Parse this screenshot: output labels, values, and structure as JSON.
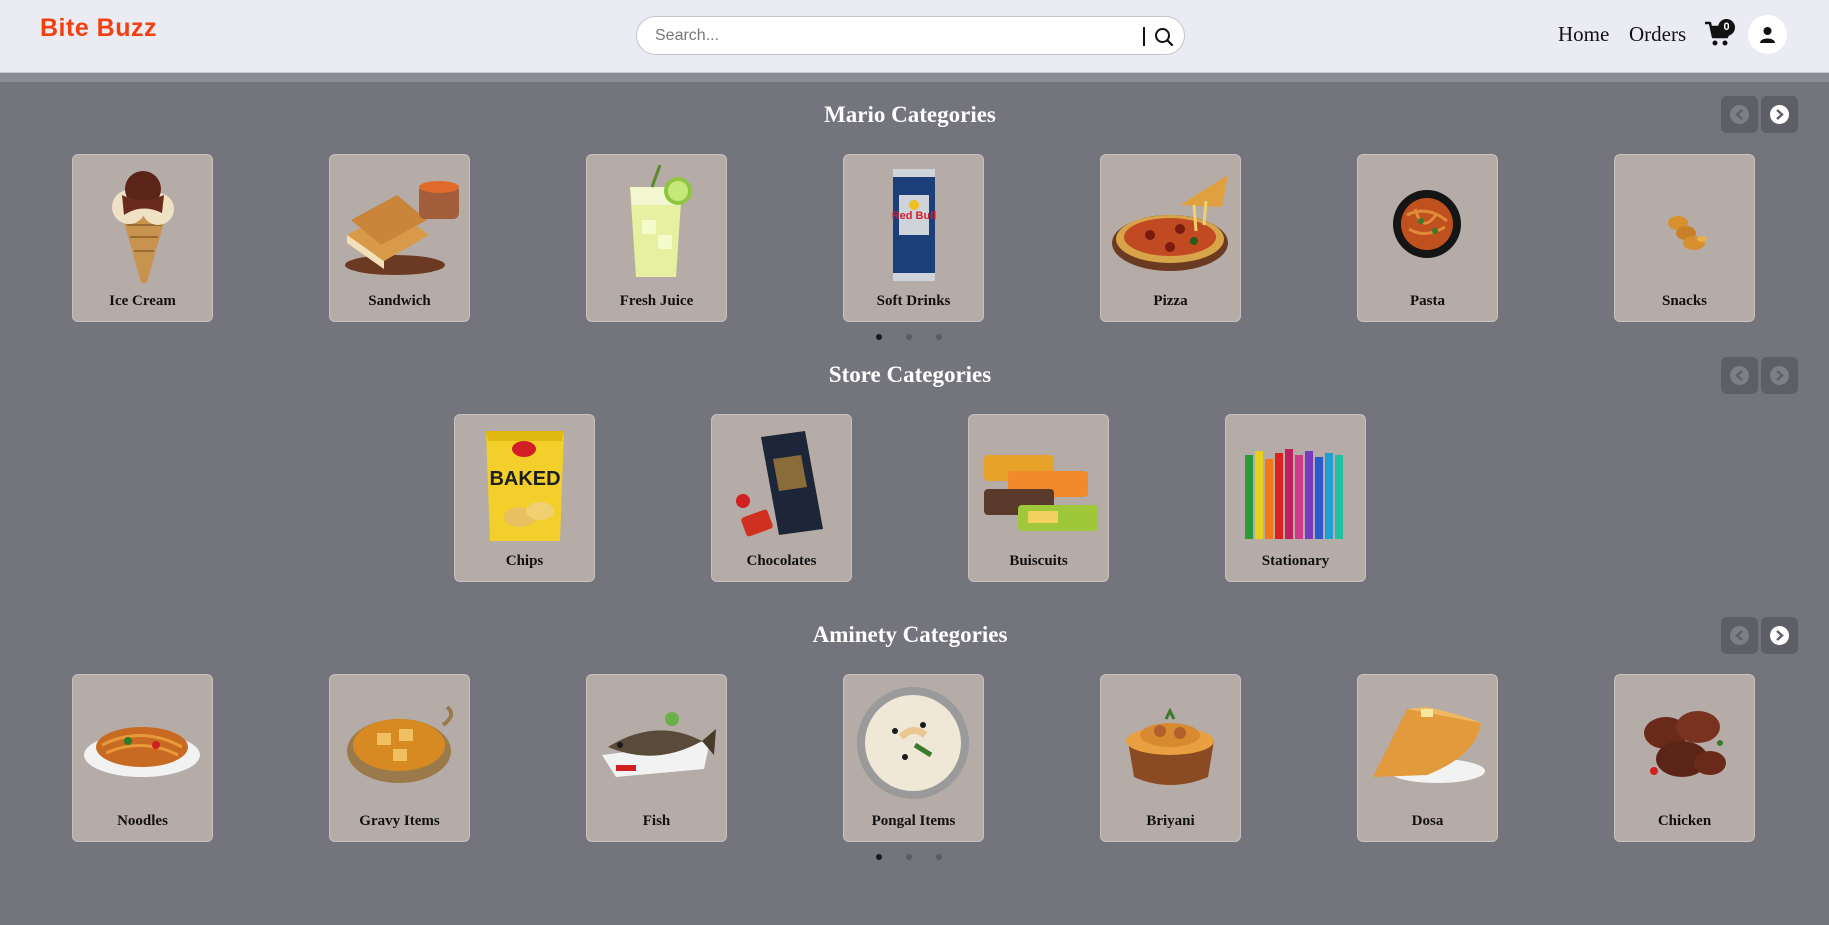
{
  "header": {
    "logo": "Bite Buzz",
    "search_placeholder": "Search...",
    "nav": {
      "home": "Home",
      "orders": "Orders"
    },
    "cart_count": "0"
  },
  "sections": [
    {
      "title": "Mario Categories",
      "prev_enabled": false,
      "next_enabled": true,
      "items": [
        "Ice Cream",
        "Sandwich",
        "Fresh Juice",
        "Soft Drinks",
        "Pizza",
        "Pasta",
        "Snacks"
      ],
      "page_count": 3,
      "active_page": 1
    },
    {
      "title": "Store Categories",
      "prev_enabled": false,
      "next_enabled": false,
      "items": [
        "Chips",
        "Chocolates",
        "Buiscuits",
        "Stationary"
      ]
    },
    {
      "title": "Aminety Categories",
      "prev_enabled": false,
      "next_enabled": true,
      "items": [
        "Noodles",
        "Gravy Items",
        "Fish",
        "Pongal Items",
        "Briyani",
        "Dosa",
        "Chicken"
      ],
      "page_count": 3,
      "active_page": 1
    }
  ],
  "colors": {
    "brand": "#f0400e",
    "background": "#74757c",
    "card": "#b5aca8",
    "header": "#ebebf4"
  }
}
